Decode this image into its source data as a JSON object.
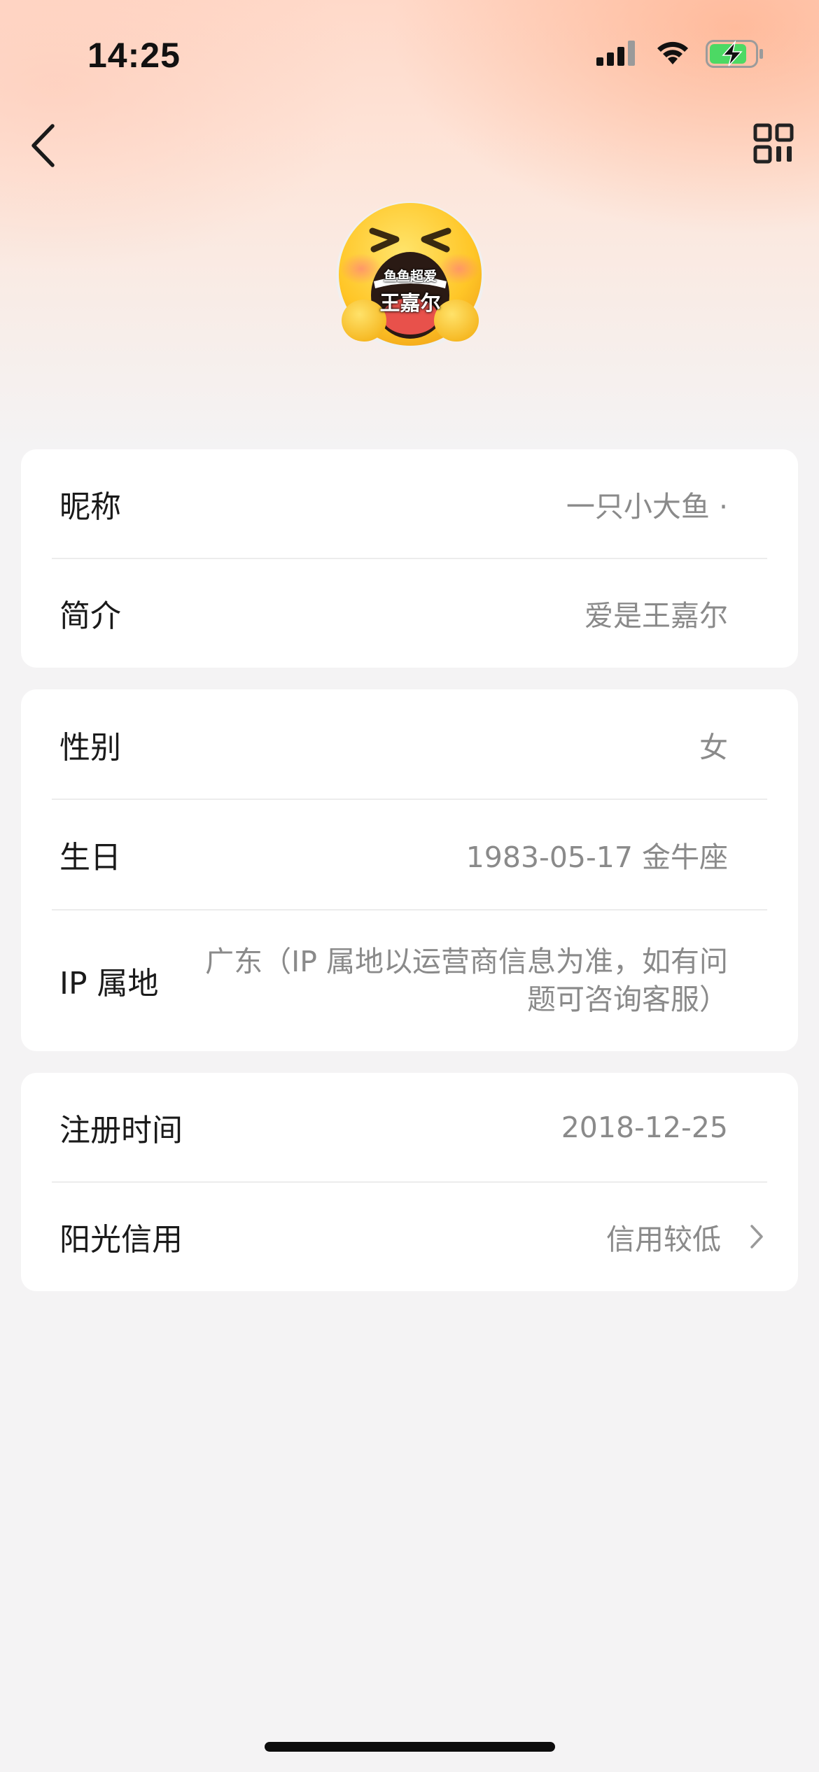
{
  "status_bar": {
    "time": "14:25",
    "icons": [
      "signal-icon",
      "wifi-icon",
      "battery-charging-icon"
    ]
  },
  "nav": {
    "back_icon": "chevron-left-icon",
    "qr_icon": "qr-code-icon"
  },
  "avatar": {
    "caption_small": "鱼鱼超爱",
    "caption_large": "王嘉尔"
  },
  "profile_info": {
    "nickname": {
      "label": "昵称",
      "value": "一只小大鱼 ·"
    },
    "bio": {
      "label": "简介",
      "value": "爱是王嘉尔"
    }
  },
  "personal_info": {
    "gender": {
      "label": "性别",
      "value": "女"
    },
    "birthday": {
      "label": "生日",
      "value": "1983-05-17 金牛座"
    },
    "ip_location": {
      "label": "IP 属地",
      "value": "广东（IP 属地以运营商信息为准，如有问题可咨询客服）"
    }
  },
  "account_info": {
    "register_time": {
      "label": "注册时间",
      "value": "2018-12-25"
    },
    "sunshine_credit": {
      "label": "阳光信用",
      "value": "信用较低"
    }
  },
  "colors": {
    "background": "#f4f3f4",
    "card": "#ffffff",
    "label_text": "#1a1a1a",
    "value_text": "#8a8a8a",
    "header_gradient_peach": "#ffd9c9"
  }
}
